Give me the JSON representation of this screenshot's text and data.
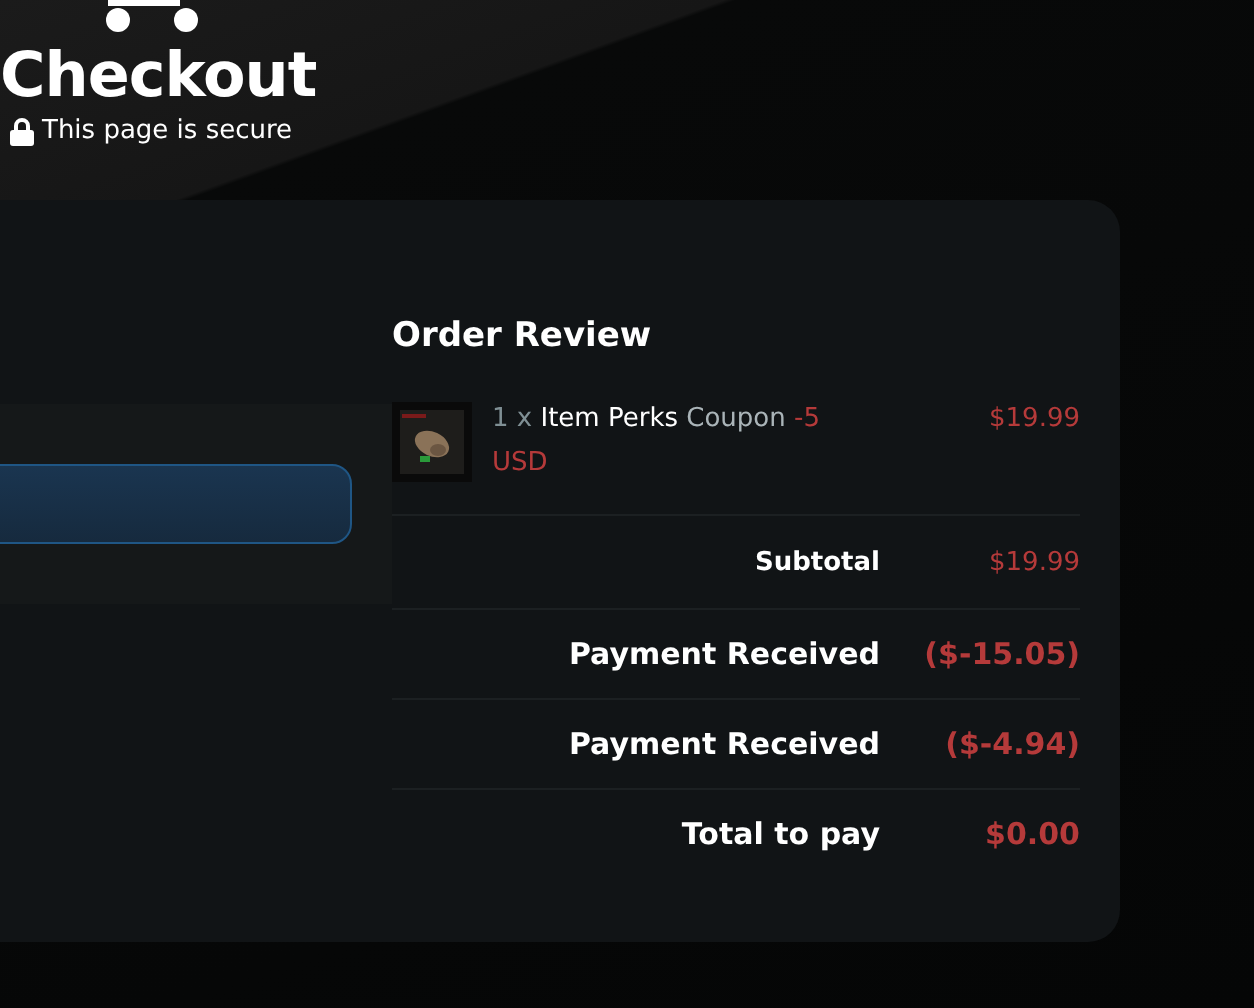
{
  "header": {
    "title": "Checkout",
    "secure_note": "This page is secure"
  },
  "order_review": {
    "title": "Order Review",
    "items": [
      {
        "quantity": "1 x",
        "name": "Item Perks",
        "type": "Coupon",
        "amount": "-5",
        "currency": "USD",
        "price": "$19.99"
      }
    ],
    "totals": [
      {
        "label": "Subtotal",
        "value": "$19.99",
        "kind": "subtotal"
      },
      {
        "label": "Payment Received",
        "value": "($-15.05)",
        "kind": "payment"
      },
      {
        "label": "Payment Received",
        "value": "($-4.94)",
        "kind": "payment"
      },
      {
        "label": "Total to pay",
        "value": "$0.00",
        "kind": "total"
      }
    ]
  }
}
